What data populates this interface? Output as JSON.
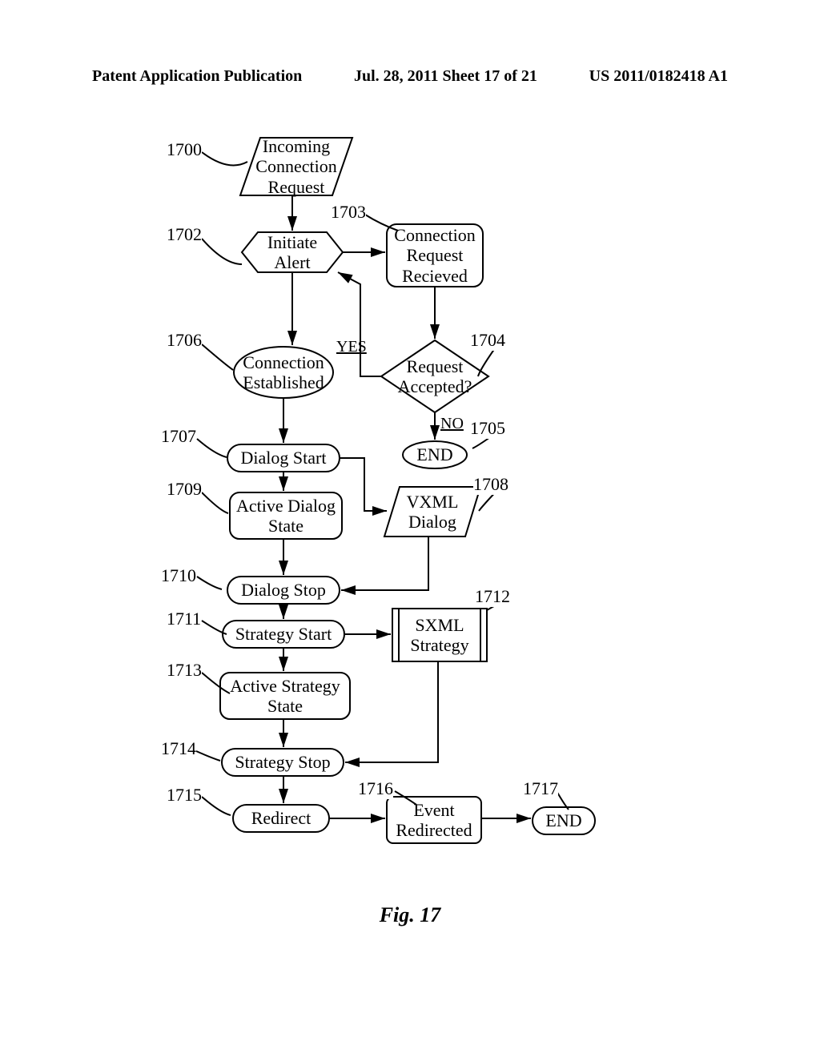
{
  "header": {
    "left": "Patent Application Publication",
    "center": "Jul. 28, 2011  Sheet 17 of 21",
    "right": "US 2011/0182418 A1"
  },
  "labels": {
    "n1700": "1700",
    "n1702": "1702",
    "n1703": "1703",
    "n1704": "1704",
    "n1705": "1705",
    "n1706": "1706",
    "n1707": "1707",
    "n1708": "1708",
    "n1709": "1709",
    "n1710": "1710",
    "n1711": "1711",
    "n1712": "1712",
    "n1713": "1713",
    "n1714": "1714",
    "n1715": "1715",
    "n1716": "1716",
    "n1717": "1717"
  },
  "nodes": {
    "incoming": "Incoming\nConnection\nRequest",
    "initiate": "Initiate\nAlert",
    "connreq": "Connection\nRequest\nRecieved",
    "accepted": "Request\nAccepted?",
    "end1": "END",
    "connest": "Connection\nEstablished",
    "dlgstart": "Dialog Start",
    "vxml": "VXML\nDialog",
    "actdlg": "Active Dialog\nState",
    "dlgstop": "Dialog Stop",
    "stratstart": "Strategy Start",
    "sxml": "SXML\nStrategy",
    "actstrat": "Active Strategy\nState",
    "stratstop": "Strategy Stop",
    "redirect": "Redirect",
    "eventred": "Event\nRedirected",
    "end2": "END"
  },
  "edges": {
    "yes": "YES",
    "no": "NO"
  },
  "caption": "Fig. 17"
}
